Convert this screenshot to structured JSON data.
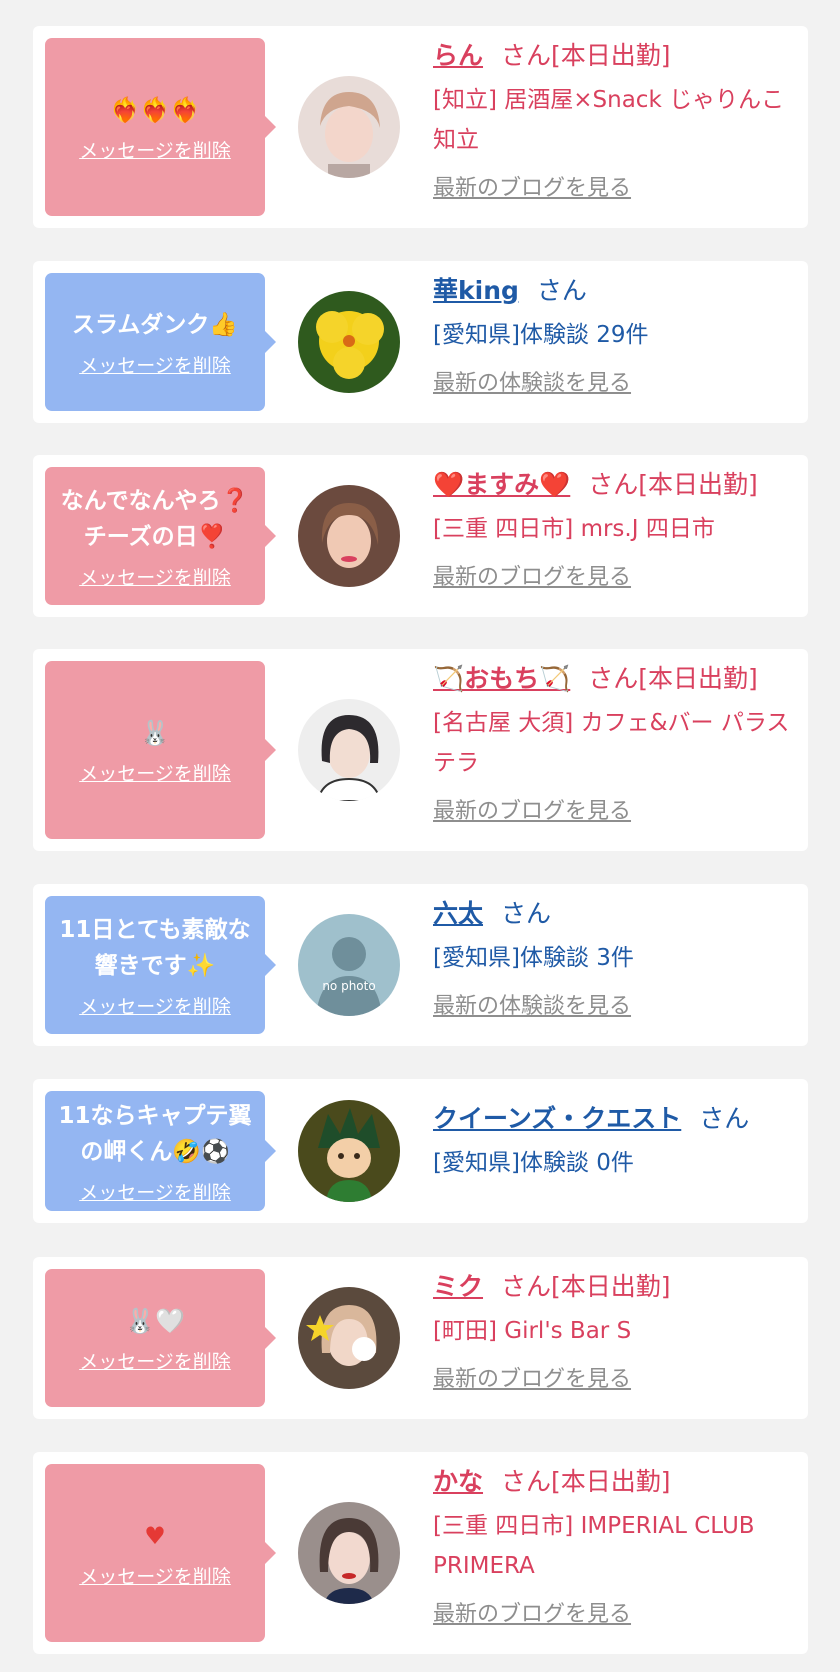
{
  "colors": {
    "pink": "#ef9ba6",
    "blue": "#94b6f2",
    "cast": "#d9405e",
    "user": "#1f5aa6",
    "link": "#8e8e8e"
  },
  "delete_label": "メッセージを削除",
  "items": [
    {
      "bubble": "pink",
      "message": "",
      "emoji": "❤️‍🔥❤️‍🔥❤️‍🔥",
      "name": "らん",
      "suffix": "さん[本日出勤]",
      "shop": "[知立] 居酒屋×Snack じゃりんこ知立",
      "link": "最新のブログを見る",
      "avatar_icon": "woman-photo-icon"
    },
    {
      "bubble": "blue",
      "message": "スラムダンク👍",
      "emoji": "",
      "name": "華king",
      "suffix": "さん",
      "shop": "[愛知県]体験談 29件",
      "link": "最新の体験談を見る",
      "avatar_icon": "yellow-flower-icon"
    },
    {
      "bubble": "pink",
      "message": "なんでなんやろ❓\nチーズの日❣️",
      "emoji": "",
      "name": "❤️ますみ❤️",
      "suffix": "さん[本日出勤]",
      "shop": "[三重 四日市] mrs.J 四日市",
      "link": "最新のブログを見る",
      "avatar_icon": "woman-photo-icon"
    },
    {
      "bubble": "pink",
      "message": "",
      "emoji": "🐰",
      "name": "🏹おもち🏹",
      "suffix": "さん[本日出勤]",
      "shop": "[名古屋 大須] カフェ&バー パラステラ",
      "link": "最新のブログを見る",
      "avatar_icon": "woman-photo-icon"
    },
    {
      "bubble": "blue",
      "message": "11日とても素敵な\n響きです✨",
      "emoji": "",
      "name": "六太",
      "suffix": "さん",
      "shop": "[愛知県]体験談 3件",
      "link": "最新の体験談を見る",
      "avatar_icon": "no-photo-icon",
      "avatar_text": "no photo"
    },
    {
      "bubble": "blue",
      "message": "11ならキャプテ翼\nの岬くん🤣⚽",
      "emoji": "",
      "name": "クイーンズ・クエスト",
      "suffix": "さん",
      "shop": "[愛知県]体験談 0件",
      "link": "",
      "avatar_icon": "anime-character-icon"
    },
    {
      "bubble": "pink",
      "message": "",
      "emoji": "🐰🤍",
      "name": "ミク",
      "suffix": "さん[本日出勤]",
      "shop": "[町田] Girl's Bar S",
      "link": "最新のブログを見る",
      "avatar_icon": "woman-photo-icon"
    },
    {
      "bubble": "pink",
      "message": "",
      "emoji": "♥",
      "name": "かな",
      "suffix": "さん[本日出勤]",
      "shop": "[三重 四日市] IMPERIAL CLUB PRIMERA",
      "link": "最新のブログを見る",
      "avatar_icon": "woman-photo-icon"
    }
  ]
}
